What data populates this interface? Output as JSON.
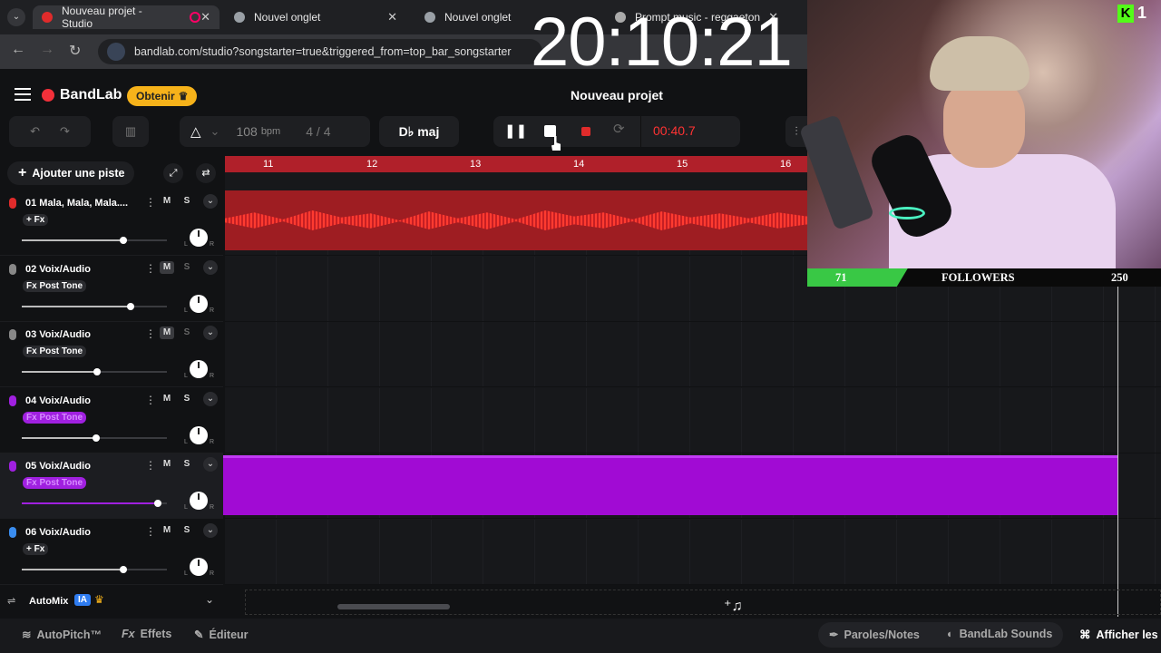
{
  "browser": {
    "tabs": [
      {
        "label": "Nouveau projet - Studio",
        "active": true
      },
      {
        "label": "Nouvel onglet",
        "active": false
      },
      {
        "label": "Nouvel onglet",
        "active": false
      },
      {
        "label": "Prompt music - reggaeton",
        "active": false
      }
    ],
    "url": "bandlab.com/studio?songstarter=true&triggered_from=top_bar_songstarter"
  },
  "overlay_clock": "20:10:21",
  "bandlab": {
    "logo": "BandLab",
    "obtenir": "Obtenir",
    "project_title": "Nouveau projet",
    "bpm": "108",
    "bpm_unit": "bpm",
    "time_sig_num": "4",
    "time_sig_sep": "/",
    "time_sig_den": "4",
    "key": "D♭ maj",
    "time": "00:40.7",
    "add_track": "Ajouter une piste"
  },
  "ruler": {
    "bars": [
      "11",
      "12",
      "13",
      "14",
      "15",
      "16"
    ]
  },
  "tracks": [
    {
      "name": "01  Mala, Mala, Mala....",
      "fx": "+ Fx",
      "mute": "M",
      "solo": "S",
      "color": "#e02b2b",
      "volume": 0.7
    },
    {
      "name": "02  Voix/Audio",
      "fx": "Fx Post Tone",
      "mute": "M",
      "solo": "S",
      "color": "#888888",
      "volume": 0.75
    },
    {
      "name": "03  Voix/Audio",
      "fx": "Fx Post Tone",
      "mute": "M",
      "solo": "S",
      "color": "#888888",
      "volume": 0.52
    },
    {
      "name": "04  Voix/Audio",
      "fx": "Fx Post Tone",
      "mute": "M",
      "solo": "S",
      "color": "#a020e0",
      "volume": 0.51
    },
    {
      "name": "05  Voix/Audio",
      "fx": "Fx Post Tone",
      "mute": "M",
      "solo": "S",
      "color": "#a020e0",
      "volume": 0.94
    },
    {
      "name": "06  Voix/Audio",
      "fx": "+ Fx",
      "mute": "M",
      "solo": "S",
      "color": "#3a8df0",
      "volume": 0.7
    }
  ],
  "pan_labels": {
    "l": "L",
    "r": "R"
  },
  "automix": {
    "label": "AutoMix",
    "badge": "IA"
  },
  "bottom": {
    "autopitch": "AutoPitch™",
    "effets": "Effets",
    "editeur": "Éditeur",
    "paroles": "Paroles/Notes",
    "sounds": "BandLab Sounds",
    "afficher": "Afficher les r"
  },
  "stream": {
    "kick_count": "1",
    "followers_current": "71",
    "followers_label": "FOLLOWERS",
    "followers_goal": "250",
    "followers_progress": 0.284
  }
}
